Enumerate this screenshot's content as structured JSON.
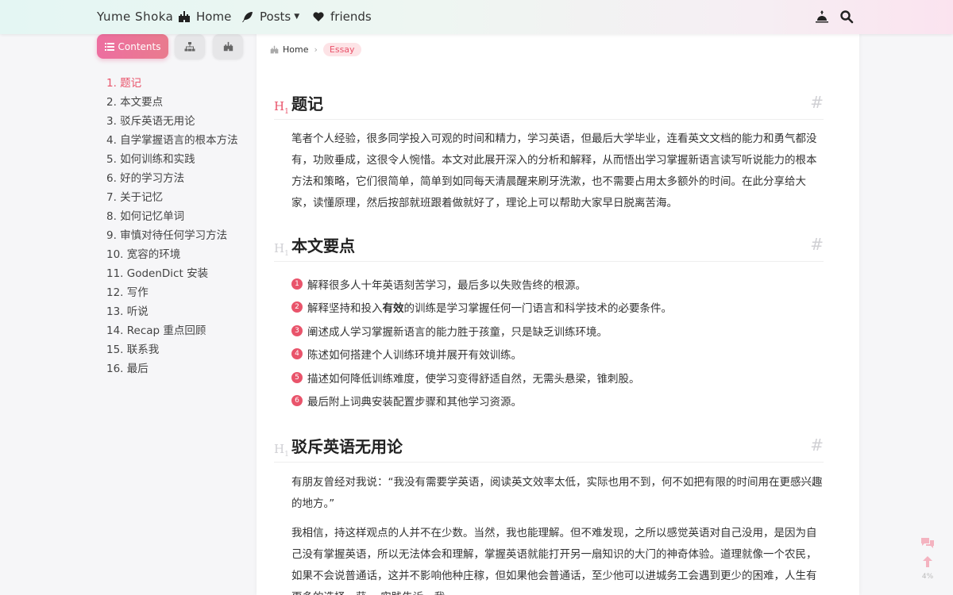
{
  "header": {
    "brand": "Yume Shoka",
    "nav": [
      {
        "label": "Home",
        "icon": "castle-icon"
      },
      {
        "label": "Posts",
        "icon": "feather-icon"
      },
      {
        "label": "friends",
        "icon": "heart-icon"
      }
    ],
    "right_icons": [
      "theme-sunrise-icon",
      "search-icon"
    ]
  },
  "sidebar": {
    "tabs": {
      "contents_label": "Contents",
      "tab2_icon": "sitemap-icon",
      "tab3_icon": "castle-icon"
    },
    "toc": [
      "1. 题记",
      "2. 本文要点",
      "3. 驳斥英语无用论",
      "4. 自学掌握语言的根本方法",
      "5. 如何训练和实践",
      "6. 好的学习方法",
      "7. 关于记忆",
      "8. 如何记忆单词",
      "9. 审慎对待任何学习方法",
      "10. 宽容的环境",
      "11. GodenDict 安装",
      "12. 写作",
      "13. 听说",
      "14. Recap 重点回顾",
      "15. 联系我",
      "16. 最后"
    ]
  },
  "breadcrumb": {
    "home": "Home",
    "category": "Essay"
  },
  "article": {
    "h_mark": "H",
    "h_sub": "1",
    "anchor": "#",
    "sections": [
      {
        "title": "题记"
      },
      {
        "title": "本文要点"
      },
      {
        "title": "驳斥英语无用论"
      }
    ],
    "intro_paragraph": "笔者个人经验，很多同学投入可观的时间和精力，学习英语，但最后大学毕业，连看英文文档的能力和勇气都没有，功败垂成，这很令人惋惜。本文对此展开深入的分析和解释，从而悟出学习掌握新语言读写听说能力的根本方法和策略，它们很简单，简单到如同每天清晨醒来刷牙洗漱，也不需要占用太多额外的时间。在此分享给大家，读懂原理，然后按部就班跟着做就好了，理论上可以帮助大家早日脱离苦海。",
    "points": [
      {
        "pre": "解释很多人十年英语刻苦学习，最后多以失败告终的根源。",
        "strong": "",
        "post": ""
      },
      {
        "pre": "解释坚持和投入",
        "strong": "有效",
        "post": "的训练是学习掌握任何一门语言和科学技术的必要条件。"
      },
      {
        "pre": "阐述成人学习掌握新语言的能力胜于孩童，只是缺乏训练环境。",
        "strong": "",
        "post": ""
      },
      {
        "pre": "陈述如何搭建个人训练环境并展开有效训练。",
        "strong": "",
        "post": ""
      },
      {
        "pre": "描述如何降低训练难度，使学习变得舒适自然，无需头悬梁，锥刺股。",
        "strong": "",
        "post": ""
      },
      {
        "pre": "最后附上词典安装配置步骤和其他学习资源。",
        "strong": "",
        "post": ""
      }
    ],
    "refute_p1": "有朋友曾经对我说：“我没有需要学英语，阅读英文效率太低，实际也用不到，何不如把有限的时间用在更感兴趣的地方。”",
    "refute_p2": "我相信，持这样观点的人并不在少数。当然，我也能理解。但不难发现，之所以感觉英语对自己没用，是因为自己没有掌握英语，所以无法体会和理解，掌握英语就能打开另一扇知识的大门的神奇体验。道理就像一个农民，如果不会说普通话，这并不影响他种庄稼，但如果他会普通话，至少他可以进城务工会遇到更少的困难，人生有更多的选择，获… 实践告诉…我…"
  },
  "float": {
    "chat_icon": "comments-icon",
    "up_icon": "arrow-up-icon",
    "percent": "4%"
  },
  "colors": {
    "accent": "#e9546b",
    "tab_gradient_start": "#ed6ea0",
    "tab_gradient_end": "#e97b8e"
  }
}
